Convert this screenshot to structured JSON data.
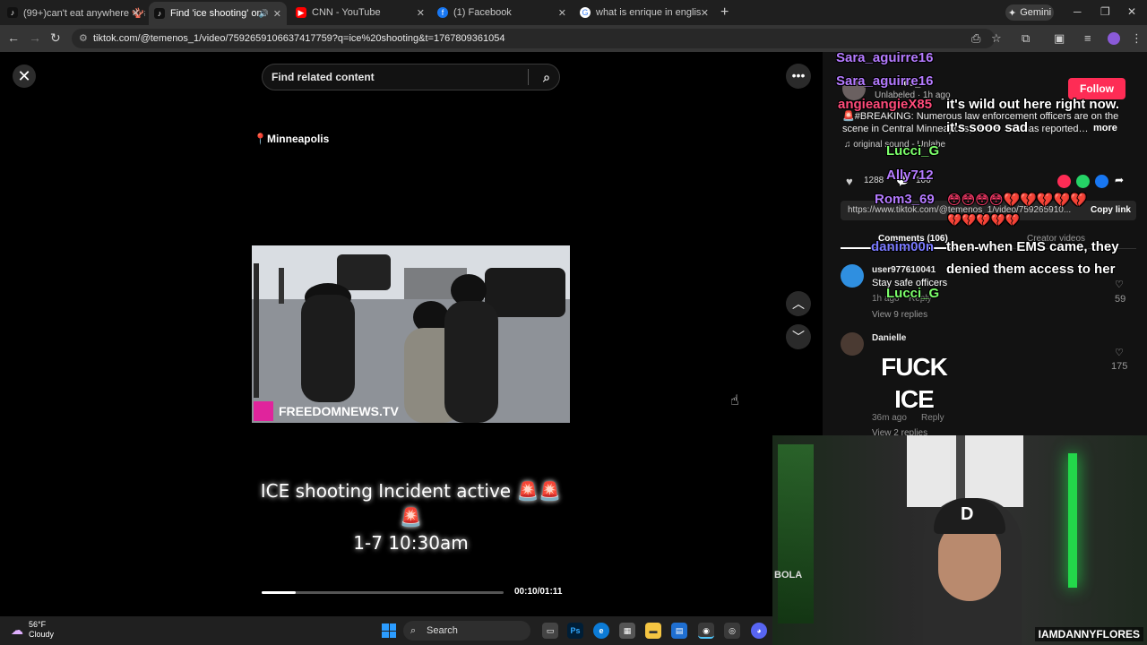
{
  "tabs": [
    {
      "title": "(99+)can't eat anywhere 🪸#fy",
      "icon": "tiktok-icon",
      "color": "#111111"
    },
    {
      "title": "Find 'ice shooting' on TikTo",
      "icon": "tiktok-icon",
      "color": "#111111",
      "active": true
    },
    {
      "title": "CNN - YouTube",
      "icon": "youtube-icon",
      "color": "#ff0000"
    },
    {
      "title": "(1) Facebook",
      "icon": "facebook-icon",
      "color": "#1877f2"
    },
    {
      "title": "what is enrique in english - Goo",
      "icon": "google-icon",
      "color": "#ffffff"
    }
  ],
  "gemini_label": "Gemini",
  "url": "tiktok.com/@temenos_1/video/7592659106637417759?q=ice%20shooting&t=1767809361054",
  "search": {
    "placeholder": "Find related content"
  },
  "video": {
    "location": "Minneapolis",
    "watermark": "FREEDOMNEWS.TV",
    "caption_line1": "ICE shooting Incident active 🚨🚨",
    "caption_line2": "🚨",
    "caption_line3": "1-7 10:30am",
    "time": "00:10/01:11",
    "progress": 0.14
  },
  "post": {
    "username": "temenos_1",
    "meta": "Unlabeled · 1h ago",
    "follow": "Follow",
    "text": "🚨#BREAKING: Numerous law enforcement officers are on the scene in Central Minneapolis, where ICE has reported…",
    "more": "more",
    "sound": "♫ original sound - Unlabe",
    "likes": "1288",
    "comments_count": "106",
    "link": "https://www.tiktok.com/@temenos_1/video/759265910...",
    "copy_link": "Copy link",
    "tab_comments": "Comments (106)",
    "tab_creator": "Creator videos"
  },
  "comments": [
    {
      "user": "user977610041",
      "text": "Stay safe officers",
      "time": "1h ago",
      "reply": "Reply",
      "view": "View 9 replies",
      "likes": "59"
    },
    {
      "user": "Danielle",
      "text": "FUCK ICE",
      "time": "36m ago",
      "reply": "Reply",
      "view": "View 2 replies",
      "likes": "175"
    }
  ],
  "overlay_chat": [
    {
      "user": "Sara_aguirre16",
      "color": "#b57bff",
      "msg": ""
    },
    {
      "user": "angieangieX85",
      "color": "#ff4b7a",
      "msg": "it's wild out here right now."
    },
    {
      "user": "",
      "color": "#ffffff",
      "msg": "it's sooo sad"
    },
    {
      "user": "Lucci_G",
      "color": "#7cff6b",
      "msg": ""
    },
    {
      "user": "Ally712",
      "color": "#b57bff",
      "msg": ""
    },
    {
      "user": "Rom3_69",
      "color": "#b57bff",
      "msg": ""
    },
    {
      "user": "danim00n",
      "color": "#7a7aff",
      "msg": "then when EMS came, they"
    },
    {
      "user": "",
      "color": "#ffffff",
      "msg": "denied them access to her"
    },
    {
      "user": "Lucci_G",
      "color": "#7cff6b",
      "msg": ""
    }
  ],
  "fuck_ice": "FUCK ICE",
  "webcam": {
    "handle": "IAMDANNYFLORES",
    "sign": "BOLA",
    "cap_letter": "D"
  },
  "taskbar": {
    "temp": "56°F",
    "weather": "Cloudy",
    "search": "Search"
  }
}
